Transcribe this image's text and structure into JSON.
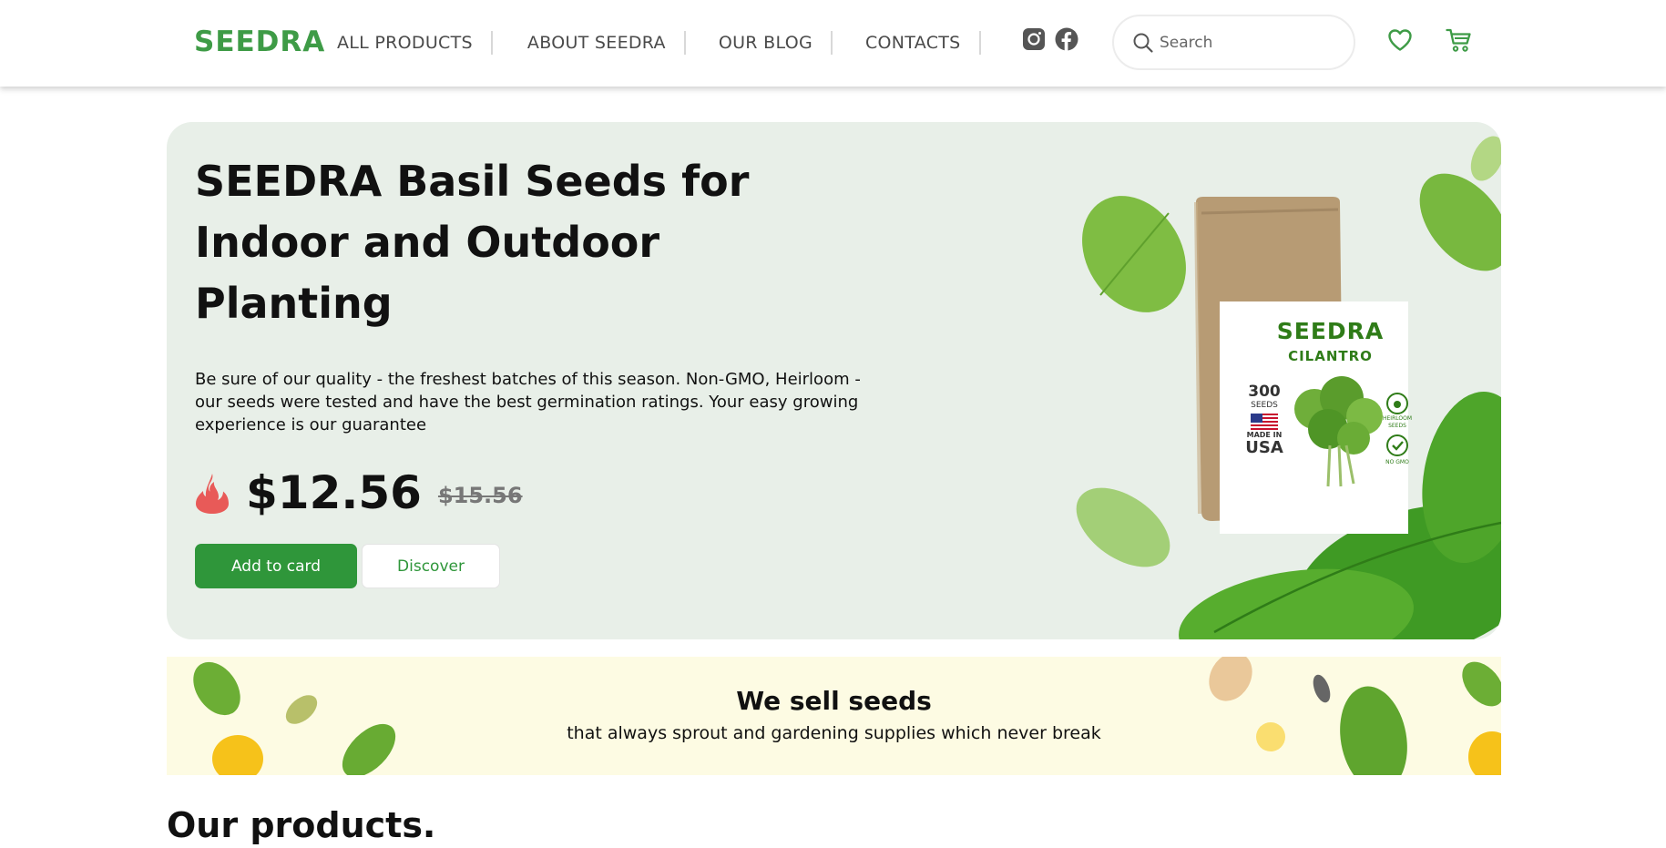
{
  "header": {
    "logo": "SEEDRA",
    "nav": [
      "ALL PRODUCTS",
      "ABOUT SEEDRA",
      "OUR BLOG",
      "CONTACTS"
    ],
    "social_icons": [
      "instagram-icon",
      "facebook-icon"
    ],
    "search_placeholder": "Search",
    "icons": [
      "heart-icon",
      "cart-icon"
    ]
  },
  "hero": {
    "title": "SEEDRA Basil Seeds for Indoor and Outdoor Planting",
    "description": "Be sure of our quality - the freshest batches of this season. Non-GMO, Heirloom - our seeds were tested and have the best germination ratings. Your easy growing experience is our guarantee",
    "price": "$12.56",
    "old_price": "$15.56",
    "add_button": "Add to card",
    "discover_button": "Discover",
    "package": {
      "brand": "SEEDRA",
      "product": "CILANTRO",
      "count": "300",
      "count_label": "SEEDS",
      "made_in": "MADE IN",
      "country": "USA",
      "badge_1": "HEIRLOOM SEEDS",
      "badge_2": "NO GMO"
    }
  },
  "banner": {
    "title": "We sell seeds",
    "subtitle": "that always sprout and gardening supplies which never break"
  },
  "products": {
    "title": "Our products."
  },
  "colors": {
    "brand_green": "#3e9b46",
    "button_green": "#2f963a",
    "hero_bg": "#e8efe8",
    "banner_bg": "#fdfbe3"
  }
}
